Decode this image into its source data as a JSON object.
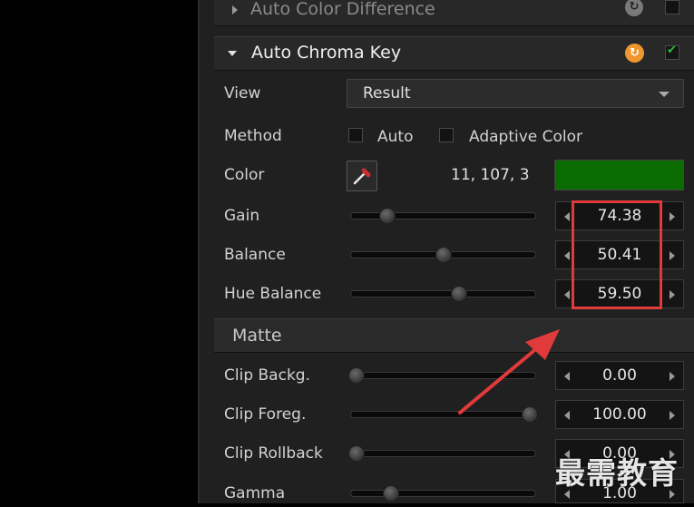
{
  "sections": {
    "color_difference": {
      "title": "Auto Color Difference",
      "enabled": false
    },
    "chroma_key": {
      "title": "Auto Chroma Key",
      "enabled": true
    },
    "matte": {
      "title": "Matte"
    }
  },
  "view": {
    "label": "View",
    "value": "Result"
  },
  "method": {
    "label": "Method",
    "auto_label": "Auto",
    "adaptive_label": "Adaptive Color"
  },
  "color": {
    "label": "Color",
    "rgb_text": "11, 107, 3",
    "swatch_color": "#0b6b03"
  },
  "key_params": [
    {
      "label": "Gain",
      "value": "74.38",
      "level": 0.18
    },
    {
      "label": "Balance",
      "value": "50.41",
      "level": 0.5
    },
    {
      "label": "Hue Balance",
      "value": "59.50",
      "level": 0.59
    }
  ],
  "matte_params": [
    {
      "label": "Clip Backg.",
      "value": "0.00",
      "level": 0.0
    },
    {
      "label": "Clip Foreg.",
      "value": "100.00",
      "level": 1.0
    },
    {
      "label": "Clip Rollback",
      "value": "0.00",
      "level": 0.0
    },
    {
      "label": "Gamma",
      "value": "1.00",
      "level": 0.2
    }
  ],
  "watermark": "最需教育",
  "colors": {
    "highlight": "#e03a3a",
    "check": "#2fbf3a",
    "reset_active": "#f0962e"
  }
}
